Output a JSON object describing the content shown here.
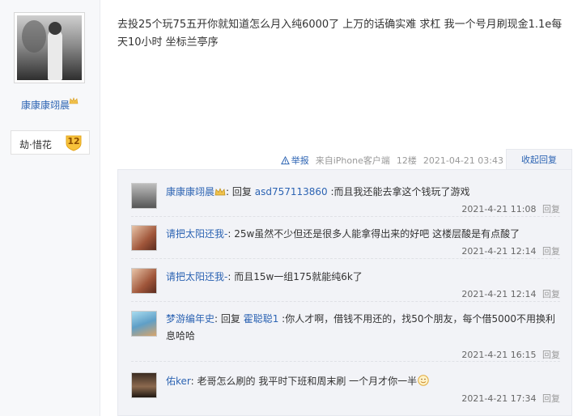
{
  "author": {
    "name": "康康康翊晨",
    "badge_name": "劫·惜花",
    "badge_level": "12"
  },
  "post": {
    "content": "去投25个玩75五开你就知道怎么月入纯6000了 上万的话确实难 求杠 我一个号月刷现金1.1e每天10小时 坐标兰亭序",
    "report_label": "举报",
    "client": "来自iPhone客户端",
    "floor": "12楼",
    "datetime": "2021-04-21 03:43",
    "collapse_label": "收起回复"
  },
  "replies": [
    {
      "user": "康康康翊晨",
      "reply_word": "回复",
      "target": "asd757113860",
      "text": " :而且我还能去拿这个钱玩了游戏",
      "time": "2021-4-21 11:08",
      "action": "回复"
    },
    {
      "user": "请把太阳还我-",
      "text": ": 25w虽然不少但还是很多人能拿得出来的好吧 这楼层酸是有点酸了",
      "time": "2021-4-21 12:14",
      "action": "回复"
    },
    {
      "user": "请把太阳还我-",
      "text": ": 而且15w一组175就能纯6k了",
      "time": "2021-4-21 12:14",
      "action": "回复"
    },
    {
      "user": "梦游编年史",
      "reply_word": "回复",
      "target": "霍聪聪1",
      "text": " :你人才啊，借钱不用还的，找50个朋友，每个借5000不用换利息哈哈",
      "time": "2021-4-21 16:15",
      "action": "回复"
    },
    {
      "user": "佑ker",
      "text": ": 老哥怎么刷的 我平时下班和周末刷 一个月才你一半",
      "time": "2021-4-21 17:34",
      "action": "回复"
    }
  ],
  "colors": {
    "link": "#2d64b3",
    "panel_bg": "#f2f3f7",
    "meta": "#999999",
    "badge_gold": "#f7c23b"
  },
  "icons": [
    "crown-icon",
    "badge-level-icon",
    "warning-icon",
    "smile-emoji-icon"
  ]
}
